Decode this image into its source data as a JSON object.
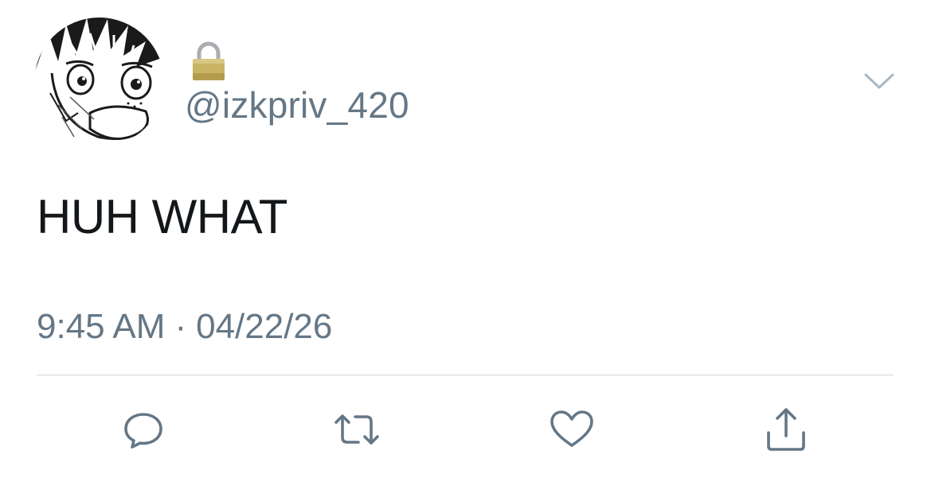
{
  "tweet": {
    "handle": "@izkpriv_420",
    "text": "HUH WHAT",
    "time": "9:45 AM",
    "separator": "·",
    "date": "04/22/26",
    "locked_icon": "lock-icon",
    "menu_icon": "chevron-down-icon"
  },
  "actions": [
    {
      "icon": "reply-icon"
    },
    {
      "icon": "retweet-icon"
    },
    {
      "icon": "heart-icon"
    },
    {
      "icon": "share-icon"
    }
  ],
  "colors": {
    "text_primary": "#14171a",
    "text_secondary": "#657786",
    "icon_gray": "#657786",
    "divider": "#cfd6dc",
    "lock_gold": "#c9b365"
  }
}
